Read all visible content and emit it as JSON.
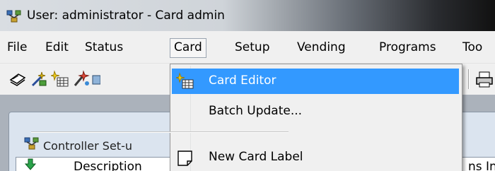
{
  "window": {
    "title": "User: administrator - Card admin"
  },
  "menubar": {
    "items": [
      {
        "label": "File"
      },
      {
        "label": "Edit"
      },
      {
        "label": "Status"
      },
      {
        "label": "Card"
      },
      {
        "label": "Setup"
      },
      {
        "label": "Vending"
      },
      {
        "label": "Programs"
      },
      {
        "label": "Too"
      }
    ],
    "open_item": "Card"
  },
  "card_menu": {
    "items": [
      {
        "label": "Card Editor",
        "icon": "card-editor-icon",
        "highlighted": true
      },
      {
        "label": "Batch Update...",
        "icon": null,
        "highlighted": false
      },
      {
        "label": "New Card Label",
        "icon": "label-icon",
        "highlighted": false
      }
    ]
  },
  "child_window": {
    "title": "Controller Set-u",
    "column_header": "Description",
    "column_header_right": "ns Inf"
  },
  "colors": {
    "highlight": "#3399ff",
    "menu_bg": "#f0f0f0",
    "workspace_bg": "#abb2bb",
    "child_frame": "#dbe4ef"
  }
}
